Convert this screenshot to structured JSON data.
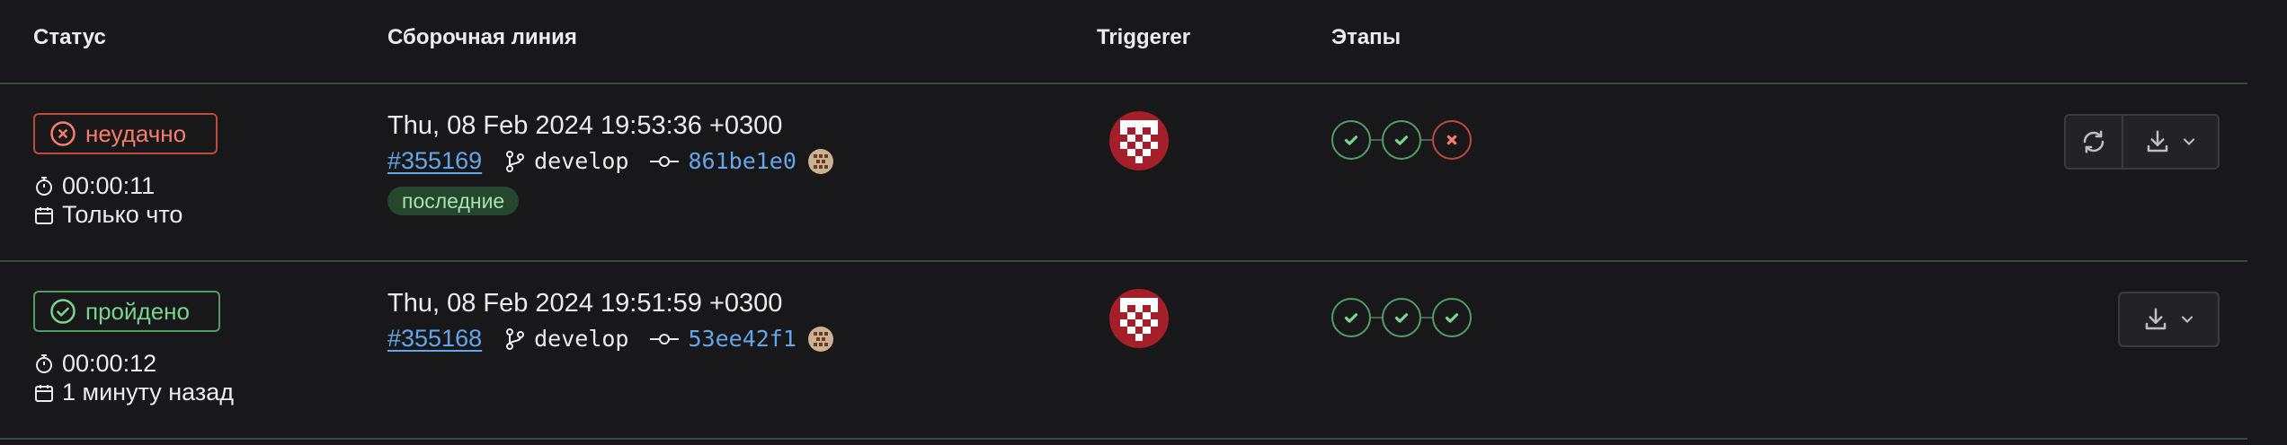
{
  "header": {
    "status": "Статус",
    "pipeline": "Сборочная линия",
    "triggerer": "Triggerer",
    "stages": "Этапы"
  },
  "colors": {
    "failed": "#f57f6c",
    "passed": "#7bd48d",
    "link": "#63a6e9",
    "background": "#18181a"
  },
  "rows": [
    {
      "status_label": "неудачно",
      "status": "failed",
      "duration": "00:00:11",
      "finished": "Только что",
      "date": "Thu, 08 Feb 2024 19:53:36 +0300",
      "pipeline_id": "#355169",
      "branch": "develop",
      "commit": "861be1e0",
      "tag": "последние",
      "stages": [
        "success",
        "success",
        "failed"
      ],
      "actions": [
        "retry-icon",
        "download-icon"
      ]
    },
    {
      "status_label": "пройдено",
      "status": "passed",
      "duration": "00:00:12",
      "finished": "1 минуту назад",
      "date": "Thu, 08 Feb 2024 19:51:59 +0300",
      "pipeline_id": "#355168",
      "branch": "develop",
      "commit": "53ee42f1",
      "stages": [
        "success",
        "success",
        "success"
      ],
      "actions": [
        "download-icon"
      ]
    }
  ]
}
